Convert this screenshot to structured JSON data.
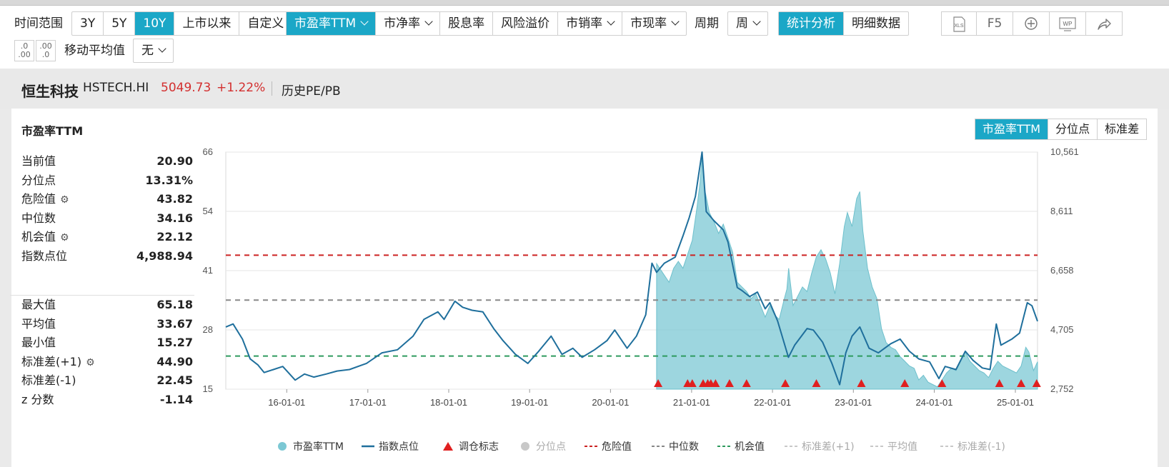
{
  "toolbar": {
    "time_range_label": "时间范围",
    "time_ranges": [
      "3Y",
      "5Y",
      "10Y",
      "上市以来",
      "自定义"
    ],
    "time_range_active": "10Y",
    "metrics": [
      {
        "label": "市盈率TTM",
        "dropdown": true
      },
      {
        "label": "市净率",
        "dropdown": true
      },
      {
        "label": "股息率",
        "dropdown": false
      },
      {
        "label": "风险溢价",
        "dropdown": false
      },
      {
        "label": "市销率",
        "dropdown": true
      },
      {
        "label": "市现率",
        "dropdown": true
      }
    ],
    "metric_active": "市盈率TTM",
    "period_label": "周期",
    "period_value": "周",
    "views": [
      "统计分析",
      "明细数据"
    ],
    "view_active": "统计分析",
    "xls_label": "XLS",
    "f5_label": "F5",
    "wp_label": "WP",
    "ma_label": "移动平均值",
    "ma_value": "无",
    "dec_inc_label": ".0",
    "dec_inc_sub": ".00",
    "dec_dec_label": ".00",
    "dec_dec_sub": ".0"
  },
  "header": {
    "name": "恒生科技",
    "code": "HSTECH.HI",
    "price": "5049.73",
    "change": "+1.22%",
    "history_link": "历史PE/PB"
  },
  "panel": {
    "title": "市盈率TTM",
    "tabs": [
      "市盈率TTM",
      "分位点",
      "标准差"
    ],
    "tab_active": "市盈率TTM"
  },
  "stats_top": [
    {
      "name": "当前值",
      "value": "20.90",
      "gear": false
    },
    {
      "name": "分位点",
      "value": "13.31%",
      "gear": false
    },
    {
      "name": "危险值",
      "value": "43.82",
      "gear": true
    },
    {
      "name": "中位数",
      "value": "34.16",
      "gear": false
    },
    {
      "name": "机会值",
      "value": "22.12",
      "gear": true
    },
    {
      "name": "指数点位",
      "value": "4,988.94",
      "gear": false
    }
  ],
  "stats_bottom": [
    {
      "name": "最大值",
      "value": "65.18",
      "gear": false
    },
    {
      "name": "平均值",
      "value": "33.67",
      "gear": false
    },
    {
      "name": "最小值",
      "value": "15.27",
      "gear": false
    },
    {
      "name": "标准差(+1)",
      "value": "44.90",
      "gear": true
    },
    {
      "name": "标准差(-1)",
      "value": "22.45",
      "gear": false
    },
    {
      "name": "z 分数",
      "value": "-1.14",
      "gear": false
    }
  ],
  "legend": [
    {
      "label": "市盈率TTM",
      "marker": "dot",
      "color": "#7cc8d4",
      "active": true
    },
    {
      "label": "指数点位",
      "marker": "line",
      "color": "#1f6f9c",
      "active": true
    },
    {
      "label": "调仓标志",
      "marker": "triangle",
      "color": "#e02020",
      "active": true
    },
    {
      "label": "分位点",
      "marker": "dot",
      "color": "#c8c8c8",
      "active": false
    },
    {
      "label": "危险值",
      "marker": "dash",
      "color": "#cc2222",
      "active": true
    },
    {
      "label": "中位数",
      "marker": "dash",
      "color": "#888888",
      "active": true
    },
    {
      "label": "机会值",
      "marker": "dash",
      "color": "#2e9a5e",
      "active": true
    },
    {
      "label": "标准差(+1)",
      "marker": "dash",
      "color": "#c8c8c8",
      "active": false
    },
    {
      "label": "平均值",
      "marker": "dash",
      "color": "#c8c8c8",
      "active": false
    },
    {
      "label": "标准差(-1)",
      "marker": "dash",
      "color": "#c8c8c8",
      "active": false
    }
  ],
  "colors": {
    "accent": "#1ba7c7",
    "up": "#d32f2f",
    "pe_fill": "#7cc8d4",
    "index_line": "#1f6f9c",
    "danger": "#cc2222",
    "median": "#888888",
    "opportunity": "#2e9a5e",
    "marker": "#e02020"
  },
  "chart_data": {
    "type": "line",
    "left_axis_ticks": [
      "66",
      "54",
      "41",
      "28",
      "15"
    ],
    "right_axis_ticks": [
      "10,561",
      "8,611",
      "6,658",
      "4,705",
      "2,752"
    ],
    "x_tick_labels": [
      "16-01-01",
      "17-01-01",
      "18-01-01",
      "19-01-01",
      "20-01-01",
      "21-01-01",
      "22-01-01",
      "23-01-01",
      "24-01-01",
      "25-01-01"
    ],
    "left_ylim": [
      15,
      66
    ],
    "right_ylim": [
      2752,
      10561
    ],
    "x_range": [
      "2015-04-01",
      "2025-04-11"
    ],
    "reference_lines": {
      "danger": 43.82,
      "median": 34.16,
      "opportunity": 22.12
    },
    "pe_series": {
      "name": "市盈率TTM",
      "start": "2020-07-27",
      "points": [
        [
          "2020-07-27",
          42.0
        ],
        [
          "2020-08-24",
          40.0
        ],
        [
          "2020-09-21",
          38.0
        ],
        [
          "2020-10-12",
          41.0
        ],
        [
          "2020-11-02",
          42.5
        ],
        [
          "2020-11-23",
          41.0
        ],
        [
          "2020-12-14",
          44.0
        ],
        [
          "2021-01-04",
          47.0
        ],
        [
          "2021-01-25",
          54.0
        ],
        [
          "2021-02-08",
          59.5
        ],
        [
          "2021-02-17",
          65.0
        ],
        [
          "2021-03-01",
          58.0
        ],
        [
          "2021-03-22",
          53.0
        ],
        [
          "2021-04-12",
          51.0
        ],
        [
          "2021-05-03",
          48.5
        ],
        [
          "2021-05-24",
          50.5
        ],
        [
          "2021-06-14",
          47.5
        ],
        [
          "2021-07-05",
          44.5
        ],
        [
          "2021-07-26",
          38.0
        ],
        [
          "2021-08-16",
          37.0
        ],
        [
          "2021-09-06",
          36.0
        ],
        [
          "2021-09-27",
          34.5
        ],
        [
          "2021-10-18",
          35.5
        ],
        [
          "2021-11-08",
          33.0
        ],
        [
          "2021-11-29",
          30.5
        ],
        [
          "2021-12-20",
          33.0
        ],
        [
          "2022-01-10",
          31.0
        ],
        [
          "2022-01-31",
          30.0
        ],
        [
          "2022-02-21",
          34.0
        ],
        [
          "2022-03-07",
          36.5
        ],
        [
          "2022-03-15",
          41.0
        ],
        [
          "2022-04-04",
          33.0
        ],
        [
          "2022-04-25",
          35.0
        ],
        [
          "2022-05-16",
          37.0
        ],
        [
          "2022-06-06",
          36.0
        ],
        [
          "2022-06-27",
          40.0
        ],
        [
          "2022-07-18",
          43.5
        ],
        [
          "2022-08-08",
          45.0
        ],
        [
          "2022-08-29",
          43.0
        ],
        [
          "2022-09-19",
          40.0
        ],
        [
          "2022-10-10",
          35.5
        ],
        [
          "2022-10-31",
          42.0
        ],
        [
          "2022-11-21",
          50.0
        ],
        [
          "2022-12-05",
          53.0
        ],
        [
          "2022-12-26",
          50.0
        ],
        [
          "2023-01-16",
          56.0
        ],
        [
          "2023-01-30",
          57.5
        ],
        [
          "2023-02-13",
          49.0
        ],
        [
          "2023-03-06",
          41.0
        ],
        [
          "2023-03-27",
          37.0
        ],
        [
          "2023-04-17",
          34.5
        ],
        [
          "2023-05-08",
          28.0
        ],
        [
          "2023-05-29",
          25.0
        ],
        [
          "2023-06-19",
          24.0
        ],
        [
          "2023-07-10",
          23.5
        ],
        [
          "2023-07-31",
          22.0
        ],
        [
          "2023-08-21",
          21.0
        ],
        [
          "2023-09-11",
          20.0
        ],
        [
          "2023-10-02",
          19.5
        ],
        [
          "2023-10-23",
          17.0
        ],
        [
          "2023-11-13",
          18.0
        ],
        [
          "2023-12-04",
          16.5
        ],
        [
          "2023-12-25",
          16.0
        ],
        [
          "2024-01-15",
          15.5
        ],
        [
          "2024-02-05",
          17.0
        ],
        [
          "2024-02-26",
          18.5
        ],
        [
          "2024-03-18",
          19.5
        ],
        [
          "2024-04-08",
          19.0
        ],
        [
          "2024-04-29",
          21.0
        ],
        [
          "2024-05-20",
          23.0
        ],
        [
          "2024-06-10",
          21.0
        ],
        [
          "2024-07-01",
          20.0
        ],
        [
          "2024-07-22",
          19.0
        ],
        [
          "2024-08-12",
          18.5
        ],
        [
          "2024-09-02",
          17.5
        ],
        [
          "2024-09-23",
          19.5
        ],
        [
          "2024-10-14",
          21.0
        ],
        [
          "2024-11-04",
          20.0
        ],
        [
          "2024-11-25",
          19.5
        ],
        [
          "2024-12-16",
          19.0
        ],
        [
          "2025-01-06",
          18.5
        ],
        [
          "2025-01-27",
          20.0
        ],
        [
          "2025-02-17",
          24.0
        ],
        [
          "2025-03-03",
          23.0
        ],
        [
          "2025-03-24",
          19.0
        ],
        [
          "2025-04-11",
          20.9
        ]
      ]
    },
    "index_series": {
      "name": "指数点位",
      "points": [
        [
          "2015-04-01",
          4800
        ],
        [
          "2015-05-04",
          4900
        ],
        [
          "2015-06-15",
          4400
        ],
        [
          "2015-07-20",
          3750
        ],
        [
          "2015-08-24",
          3550
        ],
        [
          "2015-09-21",
          3300
        ],
        [
          "2015-11-02",
          3400
        ],
        [
          "2015-12-14",
          3500
        ],
        [
          "2016-02-08",
          3050
        ],
        [
          "2016-03-21",
          3250
        ],
        [
          "2016-05-02",
          3150
        ],
        [
          "2016-06-27",
          3250
        ],
        [
          "2016-08-15",
          3350
        ],
        [
          "2016-10-10",
          3400
        ],
        [
          "2016-12-26",
          3600
        ],
        [
          "2017-03-06",
          3950
        ],
        [
          "2017-05-15",
          4050
        ],
        [
          "2017-07-24",
          4500
        ],
        [
          "2017-09-11",
          5050
        ],
        [
          "2017-11-13",
          5300
        ],
        [
          "2017-12-11",
          5050
        ],
        [
          "2018-01-29",
          5650
        ],
        [
          "2018-03-05",
          5450
        ],
        [
          "2018-04-16",
          5350
        ],
        [
          "2018-06-04",
          5300
        ],
        [
          "2018-07-23",
          4750
        ],
        [
          "2018-09-03",
          4350
        ],
        [
          "2018-10-29",
          3900
        ],
        [
          "2018-12-24",
          3600
        ],
        [
          "2019-02-11",
          4000
        ],
        [
          "2019-04-08",
          4500
        ],
        [
          "2019-05-27",
          3900
        ],
        [
          "2019-07-15",
          4100
        ],
        [
          "2019-08-26",
          3800
        ],
        [
          "2019-10-21",
          4050
        ],
        [
          "2019-12-16",
          4350
        ],
        [
          "2020-01-20",
          4700
        ],
        [
          "2020-03-16",
          4100
        ],
        [
          "2020-04-27",
          4500
        ],
        [
          "2020-06-08",
          5200
        ],
        [
          "2020-07-06",
          6900
        ],
        [
          "2020-07-27",
          6600
        ],
        [
          "2020-08-31",
          6900
        ],
        [
          "2020-10-19",
          7100
        ],
        [
          "2020-11-23",
          7800
        ],
        [
          "2020-12-21",
          8400
        ],
        [
          "2021-01-18",
          9100
        ],
        [
          "2021-02-17",
          10561
        ],
        [
          "2021-03-08",
          8600
        ],
        [
          "2021-04-12",
          8300
        ],
        [
          "2021-05-24",
          8000
        ],
        [
          "2021-06-14",
          7600
        ],
        [
          "2021-07-26",
          6100
        ],
        [
          "2021-08-16",
          6000
        ],
        [
          "2021-09-20",
          5800
        ],
        [
          "2021-10-25",
          5950
        ],
        [
          "2021-11-29",
          5400
        ],
        [
          "2021-12-20",
          5600
        ],
        [
          "2022-01-24",
          5000
        ],
        [
          "2022-03-14",
          3800
        ],
        [
          "2022-04-11",
          4200
        ],
        [
          "2022-06-06",
          4750
        ],
        [
          "2022-07-04",
          4700
        ],
        [
          "2022-08-15",
          4300
        ],
        [
          "2022-09-26",
          3600
        ],
        [
          "2022-10-31",
          2900
        ],
        [
          "2022-11-28",
          3950
        ],
        [
          "2022-12-26",
          4500
        ],
        [
          "2023-01-30",
          4800
        ],
        [
          "2023-03-13",
          4100
        ],
        [
          "2023-04-24",
          3950
        ],
        [
          "2023-06-19",
          4250
        ],
        [
          "2023-07-31",
          4400
        ],
        [
          "2023-09-11",
          4000
        ],
        [
          "2023-10-23",
          3750
        ],
        [
          "2023-12-11",
          3650
        ],
        [
          "2024-01-22",
          3100
        ],
        [
          "2024-02-19",
          3500
        ],
        [
          "2024-04-08",
          3400
        ],
        [
          "2024-05-20",
          4000
        ],
        [
          "2024-06-24",
          3700
        ],
        [
          "2024-08-05",
          3450
        ],
        [
          "2024-09-09",
          3400
        ],
        [
          "2024-10-07",
          4900
        ],
        [
          "2024-10-28",
          4200
        ],
        [
          "2024-12-16",
          4400
        ],
        [
          "2025-01-20",
          4600
        ],
        [
          "2025-02-24",
          5600
        ],
        [
          "2025-03-17",
          5500
        ],
        [
          "2025-04-11",
          4988.94
        ]
      ]
    },
    "rebalance_markers": [
      "2020-08-03",
      "2020-12-14",
      "2021-01-04",
      "2021-02-22",
      "2021-03-15",
      "2021-03-29",
      "2021-04-19",
      "2021-06-21",
      "2021-09-06",
      "2022-02-28",
      "2022-07-18",
      "2023-02-06",
      "2023-08-21",
      "2024-02-05",
      "2024-10-21",
      "2025-01-27",
      "2025-04-07"
    ]
  }
}
